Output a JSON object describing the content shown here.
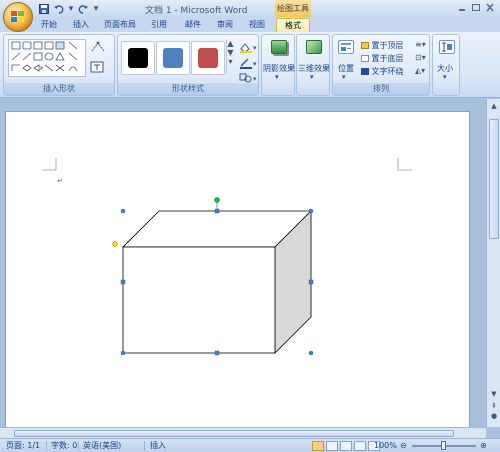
{
  "window": {
    "title": "文档 1 - Microsoft Word",
    "context_tool_title": "绘图工具"
  },
  "quick_access": {
    "save_icon": "save-icon",
    "undo_icon": "undo-icon",
    "redo_icon": "redo-icon",
    "customize_icon": "customize-icon"
  },
  "tabs": [
    {
      "label": "开始",
      "active": false
    },
    {
      "label": "插入",
      "active": false
    },
    {
      "label": "页面布局",
      "active": false
    },
    {
      "label": "引用",
      "active": false
    },
    {
      "label": "邮件",
      "active": false
    },
    {
      "label": "审阅",
      "active": false
    },
    {
      "label": "视图",
      "active": false
    },
    {
      "label": "格式",
      "active": true
    }
  ],
  "ribbon": {
    "insert_shapes": {
      "label": "插入形状"
    },
    "shape_styles": {
      "label": "形状样式",
      "swatches": [
        "#000000",
        "#4f81bd",
        "#c0504d"
      ]
    },
    "shadow_effects": {
      "label": "阴影效果"
    },
    "three_d_effects": {
      "label": "三维效果"
    },
    "arrange": {
      "label": "排列",
      "position": "位置",
      "bring_front": "置于顶层",
      "send_back": "置于底层",
      "text_wrap": "文字环绕"
    },
    "size": {
      "label": "大小"
    }
  },
  "status": {
    "page": "页面: 1/1",
    "words": "字数: 0",
    "language": "英语(美国)",
    "insert_mode": "插入",
    "zoom": "100%"
  },
  "colors": {
    "ribbon_bg": "#dbe7f6",
    "active_tab": "#fde9b4",
    "handle": "#4f81bd",
    "rotate_handle": "#22b14c",
    "adjust_handle": "#ffd800",
    "cube_side": "#d9d9d9"
  }
}
